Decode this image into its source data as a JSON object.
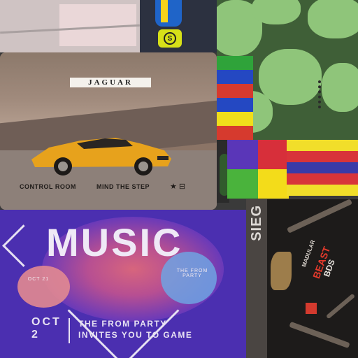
{
  "jaguar_poster": {
    "brand": "JAGUAR",
    "caption_left": "CONTROL ROOM",
    "caption_right": "MIND THE STEP"
  },
  "music_poster": {
    "title": "MUSIC",
    "small_left": "OCT 21",
    "small_right": "THE FROM PARTY",
    "date_line1": "OCT",
    "date_line2": "2",
    "tagline_line1": "THE FROM PARTY",
    "tagline_line2": "INVITES YOU TO GAME"
  },
  "shirt": {
    "side_text": "SIEG",
    "line1": "MADULAR",
    "line2": "BEAST",
    "line3": "BDS"
  },
  "badge": {
    "symbol": "S"
  },
  "colors": {
    "camo_dark": "#3f5f37",
    "camo_light": "#8fc57a",
    "music_bg": "#4b2fb0",
    "car_yellow": "#e7a21c"
  }
}
